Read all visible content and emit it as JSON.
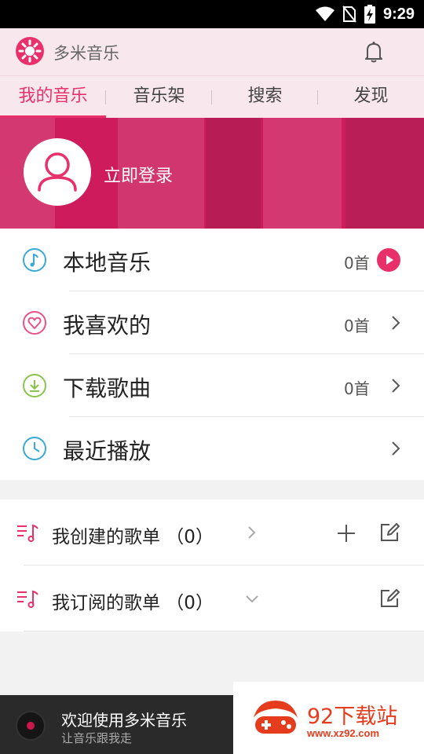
{
  "status_bar": {
    "time": "9:29"
  },
  "app_bar": {
    "title": "多米音乐"
  },
  "tabs": [
    {
      "label": "我的音乐",
      "active": true
    },
    {
      "label": "音乐架",
      "active": false
    },
    {
      "label": "搜索",
      "active": false
    },
    {
      "label": "发现",
      "active": false
    }
  ],
  "banner": {
    "login_label": "立即登录"
  },
  "library": [
    {
      "label": "本地音乐",
      "count": "0首",
      "icon": "music-note-icon",
      "icon_color": "#3aa9d8",
      "action": "play"
    },
    {
      "label": "我喜欢的",
      "count": "0首",
      "icon": "heart-icon",
      "icon_color": "#e8528a",
      "action": "arrow"
    },
    {
      "label": "下载歌曲",
      "count": "0首",
      "icon": "download-icon",
      "icon_color": "#8cc34a",
      "action": "arrow"
    },
    {
      "label": "最近播放",
      "count": "",
      "icon": "clock-icon",
      "icon_color": "#3aa9d8",
      "action": "arrow"
    }
  ],
  "playlists": [
    {
      "label": "我创建的歌单 （0）",
      "chevron": "right"
    },
    {
      "label": "我订阅的歌单 （0）",
      "chevron": "down"
    }
  ],
  "player": {
    "title": "欢迎使用多米音乐",
    "subtitle": "让音乐跟我走"
  },
  "watermark": {
    "title": "92下载站",
    "url": "www.xz92.com"
  },
  "colors": {
    "accent": "#e8316b",
    "banner": "#c81a5a",
    "tab_bar": "#f8e8ee"
  }
}
